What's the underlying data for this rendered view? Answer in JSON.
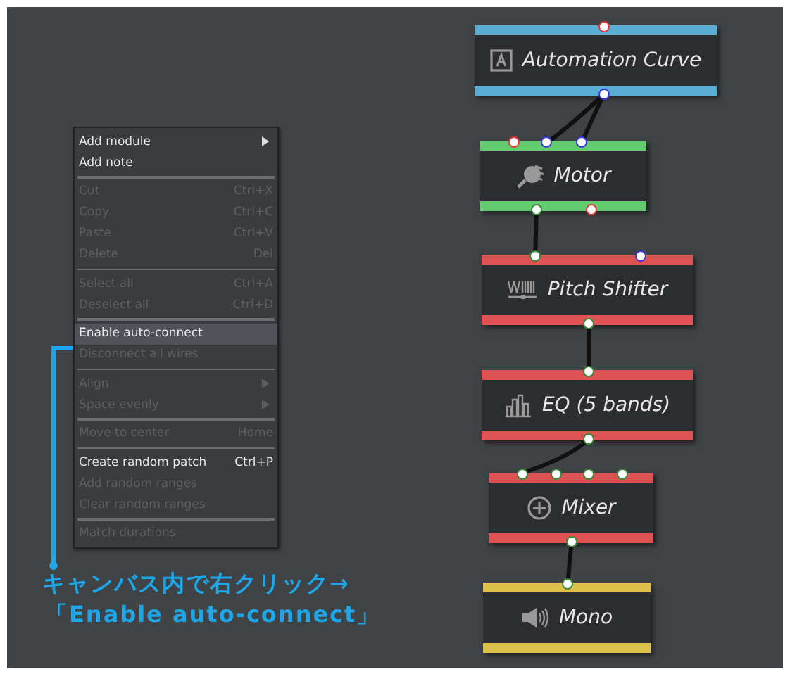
{
  "context_menu": {
    "items": [
      {
        "kind": "item",
        "label": "Add module",
        "submenu": true,
        "disabled": false,
        "highlighted": false
      },
      {
        "kind": "item",
        "label": "Add note",
        "submenu": false,
        "disabled": false,
        "highlighted": false
      },
      {
        "kind": "separator"
      },
      {
        "kind": "item",
        "label": "Cut",
        "shortcut": "Ctrl+X",
        "submenu": false,
        "disabled": true,
        "highlighted": false
      },
      {
        "kind": "item",
        "label": "Copy",
        "shortcut": "Ctrl+C",
        "submenu": false,
        "disabled": true,
        "highlighted": false
      },
      {
        "kind": "item",
        "label": "Paste",
        "shortcut": "Ctrl+V",
        "submenu": false,
        "disabled": true,
        "highlighted": false
      },
      {
        "kind": "item",
        "label": "Delete",
        "shortcut": "Del",
        "submenu": false,
        "disabled": true,
        "highlighted": false
      },
      {
        "kind": "separator"
      },
      {
        "kind": "item",
        "label": "Select all",
        "shortcut": "Ctrl+A",
        "submenu": false,
        "disabled": true,
        "highlighted": false
      },
      {
        "kind": "item",
        "label": "Deselect all",
        "shortcut": "Ctrl+D",
        "submenu": false,
        "disabled": true,
        "highlighted": false
      },
      {
        "kind": "separator"
      },
      {
        "kind": "item",
        "label": "Enable auto-connect",
        "submenu": false,
        "disabled": false,
        "highlighted": true
      },
      {
        "kind": "item",
        "label": "Disconnect all wires",
        "submenu": false,
        "disabled": true,
        "highlighted": false
      },
      {
        "kind": "separator"
      },
      {
        "kind": "item",
        "label": "Align",
        "submenu": true,
        "disabled": true,
        "highlighted": false
      },
      {
        "kind": "item",
        "label": "Space evenly",
        "submenu": true,
        "disabled": true,
        "highlighted": false
      },
      {
        "kind": "separator"
      },
      {
        "kind": "item",
        "label": "Move to center",
        "shortcut": "Home",
        "submenu": false,
        "disabled": true,
        "highlighted": false
      },
      {
        "kind": "separator"
      },
      {
        "kind": "item",
        "label": "Create random patch",
        "shortcut": "Ctrl+P",
        "submenu": false,
        "disabled": false,
        "highlighted": false
      },
      {
        "kind": "item",
        "label": "Add random ranges",
        "submenu": false,
        "disabled": true,
        "highlighted": false
      },
      {
        "kind": "item",
        "label": "Clear random ranges",
        "submenu": false,
        "disabled": true,
        "highlighted": false
      },
      {
        "kind": "separator"
      },
      {
        "kind": "item",
        "label": "Match durations",
        "submenu": false,
        "disabled": true,
        "highlighted": false
      }
    ]
  },
  "annotation": {
    "lines": [
      "キャンバス内で右クリック→",
      "「Enable auto-connect」"
    ]
  },
  "nodes": [
    {
      "title": "Automation Curve",
      "color": "#5aaed6",
      "inputs": [
        {
          "color": "#e03a3a"
        }
      ],
      "outputs": [
        {
          "color": "#3a3ae0"
        }
      ]
    },
    {
      "title": "Motor",
      "color": "#62cc6e",
      "inputs": [
        {
          "color": "#e03a3a"
        },
        {
          "color": "#3a3ae0"
        },
        {
          "color": "#3a3ae0"
        }
      ],
      "outputs": [
        {
          "color": "#3a8a3a"
        },
        {
          "color": "#e03a3a"
        }
      ]
    },
    {
      "title": "Pitch Shifter",
      "color": "#dd5252",
      "inputs": [
        {
          "color": "#3a8a3a"
        },
        {
          "color": "#3a3ae0"
        }
      ],
      "outputs": [
        {
          "color": "#3a8a3a"
        }
      ]
    },
    {
      "title": "EQ (5 bands)",
      "color": "#dd5252",
      "inputs": [
        {
          "color": "#3a8a3a"
        }
      ],
      "outputs": [
        {
          "color": "#3a8a3a"
        }
      ]
    },
    {
      "title": "Mixer",
      "color": "#dd5252",
      "inputs": [
        {
          "color": "#3a8a3a"
        },
        {
          "color": "#3a8a3a"
        },
        {
          "color": "#3a8a3a"
        },
        {
          "color": "#3a8a3a"
        }
      ],
      "outputs": [
        {
          "color": "#3a8a3a"
        }
      ]
    },
    {
      "title": "Mono",
      "color": "#dcc24a",
      "inputs": [
        {
          "color": "#3a8a3a"
        }
      ]
    }
  ]
}
